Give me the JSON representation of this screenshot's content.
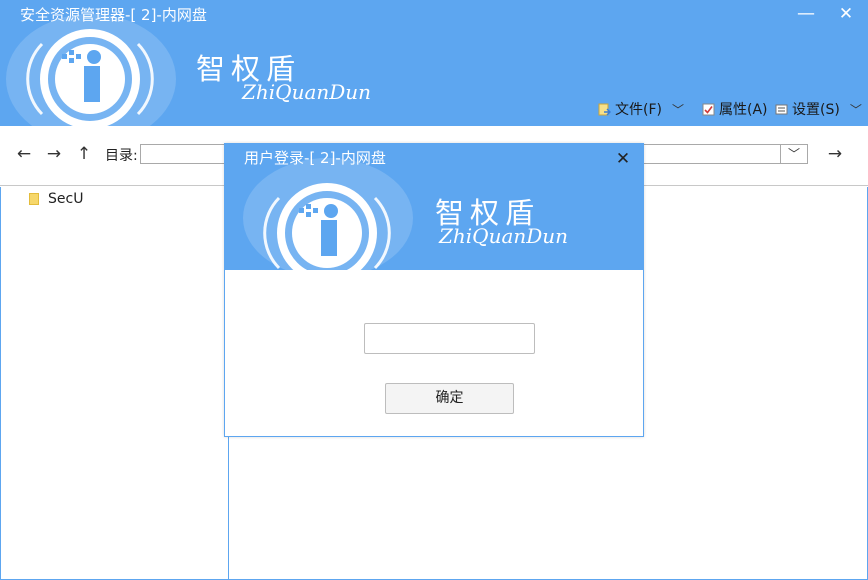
{
  "window": {
    "title": "安全资源管理器-[ 2]-内网盘",
    "minimize_icon": "minimize-icon",
    "close_icon": "close-icon"
  },
  "brand": {
    "name_cn": "智权盾",
    "name_en": "ZhiQuanDun"
  },
  "menu": {
    "items": [
      {
        "label": "文件(F)",
        "icon": "file-icon",
        "has_dropdown": true
      },
      {
        "label": "属性(A)",
        "icon": "properties-icon",
        "has_dropdown": false
      },
      {
        "label": "设置(S)",
        "icon": "settings-icon",
        "has_dropdown": true
      }
    ]
  },
  "toolbar": {
    "back_icon": "arrow-left-icon",
    "forward_icon": "arrow-right-icon",
    "up_icon": "arrow-up-icon",
    "directory_label": "目录:",
    "directory_value": "",
    "go_icon": "arrow-right-icon"
  },
  "tree": {
    "items": [
      {
        "label": "SecU",
        "icon": "folder-icon"
      }
    ]
  },
  "login_dialog": {
    "title": "用户登录-[ 2]-内网盘",
    "brand_cn": "智权盾",
    "brand_en": "ZhiQuanDun",
    "password_value": "",
    "ok_label": "确定"
  },
  "colors": {
    "header_blue": "#5da6f0",
    "white": "#ffffff",
    "border_gray": "#c8c8c8"
  }
}
